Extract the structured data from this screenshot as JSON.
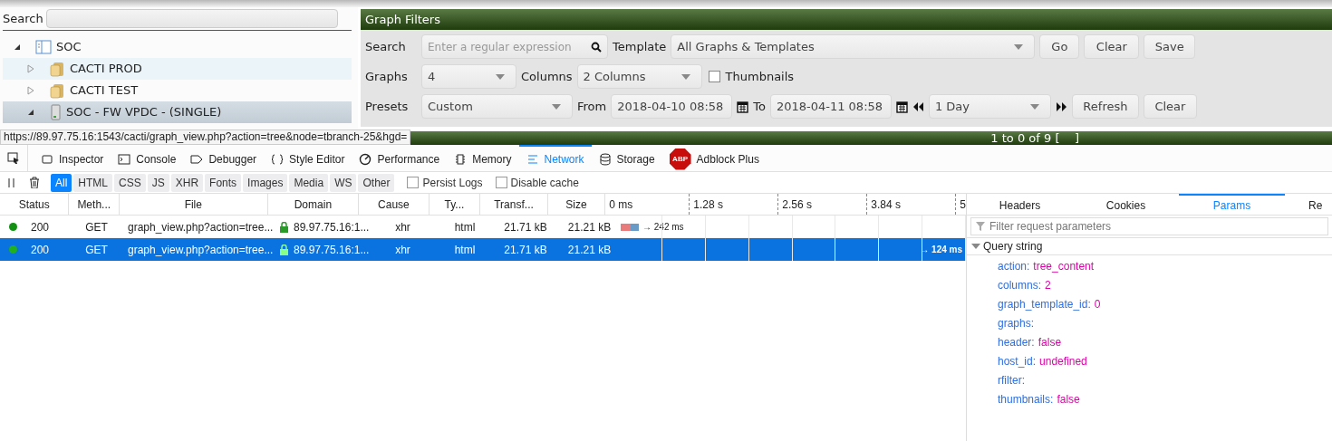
{
  "tree_panel": {
    "search_label": "Search",
    "tree": [
      {
        "label": "SOC",
        "kind": "tree",
        "expanded": true,
        "selected": false,
        "highlighted": false,
        "children": [
          {
            "label": "CACTI PROD",
            "kind": "folder",
            "expanded": false,
            "selected": false,
            "highlighted": true
          },
          {
            "label": "CACTI TEST",
            "kind": "folder",
            "expanded": false,
            "selected": false,
            "highlighted": false
          },
          {
            "label": "SOC - FW VPDC - (SINGLE)",
            "kind": "device",
            "expanded": true,
            "selected": true
          }
        ]
      }
    ]
  },
  "graph_filters": {
    "title": "Graph Filters",
    "lines": [
      {
        "items": [
          {
            "kind": "label",
            "text": "Search"
          },
          {
            "kind": "search",
            "placeholder": "Enter a regular expression"
          },
          {
            "kind": "label",
            "text": "Template"
          },
          {
            "kind": "select",
            "value": "All Graphs & Templates"
          },
          {
            "kind": "button",
            "text": "Go"
          },
          {
            "kind": "button",
            "text": "Clear"
          },
          {
            "kind": "button",
            "text": "Save"
          }
        ]
      },
      {
        "items": [
          {
            "kind": "label",
            "text": "Graphs"
          },
          {
            "kind": "select",
            "value": "4"
          },
          {
            "kind": "label",
            "text": "Columns"
          },
          {
            "kind": "select",
            "value": "2 Columns"
          },
          {
            "kind": "checkbox",
            "text": "Thumbnails",
            "checked": false
          }
        ]
      },
      {
        "items": [
          {
            "kind": "label",
            "text": "Presets"
          },
          {
            "kind": "select",
            "value": "Custom"
          },
          {
            "kind": "label",
            "text": "From"
          },
          {
            "kind": "date",
            "value": "2018-04-10 08:58"
          },
          {
            "kind": "calendar"
          },
          {
            "kind": "label",
            "text": "To"
          },
          {
            "kind": "date",
            "value": "2018-04-11 08:58"
          },
          {
            "kind": "calendar"
          },
          {
            "kind": "prev"
          },
          {
            "kind": "select",
            "value": "1 Day"
          },
          {
            "kind": "next"
          },
          {
            "kind": "button",
            "text": "Refresh"
          },
          {
            "kind": "button",
            "text": "Clear"
          }
        ]
      }
    ]
  },
  "status_url": "https://89.97.75.16:1543/cacti/graph_view.php?action=tree&node=tbranch-25&hgd=",
  "pager": "1 to 0 of 9 [    ]",
  "devtools": {
    "tabs": [
      {
        "label": "Inspector",
        "selected": false
      },
      {
        "label": "Console",
        "selected": false
      },
      {
        "label": "Debugger",
        "selected": false
      },
      {
        "label": "Style Editor",
        "selected": false
      },
      {
        "label": "Performance",
        "selected": false
      },
      {
        "label": "Memory",
        "selected": false
      },
      {
        "label": "Network",
        "selected": true
      },
      {
        "label": "Storage",
        "selected": false
      },
      {
        "label": "Adblock Plus",
        "selected": false
      }
    ],
    "abp_badge": "ABP",
    "type_filters": [
      {
        "label": "All",
        "selected": true
      },
      {
        "label": "HTML",
        "selected": false
      },
      {
        "label": "CSS",
        "selected": false
      },
      {
        "label": "JS",
        "selected": false
      },
      {
        "label": "XHR",
        "selected": false
      },
      {
        "label": "Fonts",
        "selected": false
      },
      {
        "label": "Images",
        "selected": false
      },
      {
        "label": "Media",
        "selected": false
      },
      {
        "label": "WS",
        "selected": false
      },
      {
        "label": "Other",
        "selected": false
      }
    ],
    "options": [
      {
        "label": "Persist Logs",
        "checked": false
      },
      {
        "label": "Disable cache",
        "checked": false
      }
    ],
    "table": {
      "columns": [
        "Status",
        "Meth...",
        "File",
        "Domain",
        "Cause",
        "Ty...",
        "Transf...",
        "Size"
      ],
      "ticks": [
        "0 ms",
        "1.28 s",
        "2.56 s",
        "3.84 s",
        "5"
      ],
      "rows": [
        {
          "status": "200",
          "method": "GET",
          "file": "graph_view.php?action=tree...",
          "domain": "89.97.75.16:1...",
          "cause": "xhr",
          "type": "html",
          "transferred": "21.71 kB",
          "size": "21.21 kB",
          "timing": "→ 242 ms",
          "bar_shown": true,
          "selected": false,
          "color": "#129012"
        },
        {
          "status": "200",
          "method": "GET",
          "file": "graph_view.php?action=tree...",
          "domain": "89.97.75.16:1...",
          "cause": "xhr",
          "type": "html",
          "transferred": "21.71 kB",
          "size": "21.21 kB",
          "timing": "→ 124 ms",
          "bar_shown": false,
          "selected": true,
          "color": "#20b020"
        }
      ]
    },
    "details": {
      "tabs": [
        {
          "label": "Headers",
          "selected": false
        },
        {
          "label": "Cookies",
          "selected": false
        },
        {
          "label": "Params",
          "selected": true
        },
        {
          "label": "Re",
          "selected": false
        }
      ],
      "filter_placeholder": "Filter request parameters",
      "section": {
        "title": "Query string",
        "expanded": true,
        "params": [
          {
            "name": "action:",
            "value": "tree_content"
          },
          {
            "name": "columns:",
            "value": "2"
          },
          {
            "name": "graph_template_id:",
            "value": "0"
          },
          {
            "name": "graphs:"
          },
          {
            "name": "header:",
            "value": "false"
          },
          {
            "name": "host_id:",
            "value": "undefined"
          },
          {
            "name": "rfilter:"
          },
          {
            "name": "thumbnails:",
            "value": "false"
          }
        ]
      }
    }
  }
}
